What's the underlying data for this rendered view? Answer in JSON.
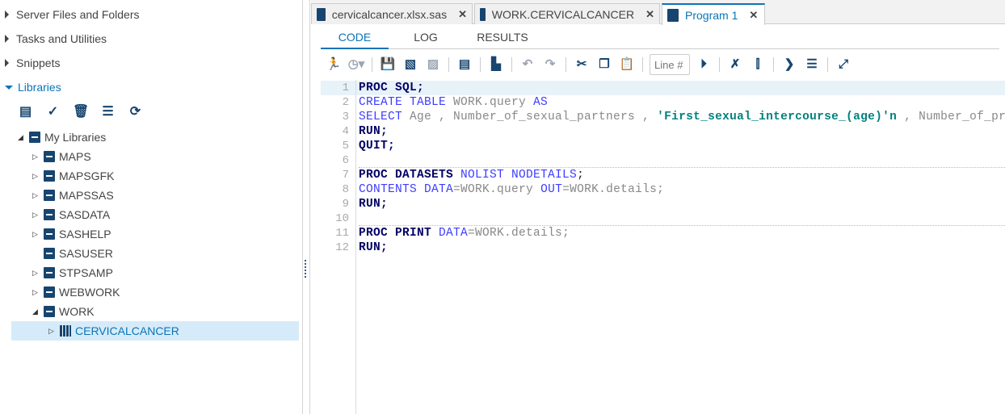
{
  "left": {
    "sections": [
      {
        "label": "Server Files and Folders",
        "expanded": false
      },
      {
        "label": "Tasks and Utilities",
        "expanded": false
      },
      {
        "label": "Snippets",
        "expanded": false
      },
      {
        "label": "Libraries",
        "expanded": true
      }
    ],
    "lib_tools": [
      {
        "icon": "new-library-icon"
      },
      {
        "icon": "properties-icon"
      },
      {
        "icon": "delete-icon"
      },
      {
        "icon": "view-columns-icon"
      },
      {
        "icon": "refresh-icon"
      }
    ],
    "root": "My Libraries",
    "libraries": [
      {
        "name": "MAPS",
        "expandable": true
      },
      {
        "name": "MAPSGFK",
        "expandable": true
      },
      {
        "name": "MAPSSAS",
        "expandable": true
      },
      {
        "name": "SASDATA",
        "expandable": true
      },
      {
        "name": "SASHELP",
        "expandable": true
      },
      {
        "name": "SASUSER",
        "expandable": false
      },
      {
        "name": "STPSAMP",
        "expandable": true
      },
      {
        "name": "WEBWORK",
        "expandable": true
      },
      {
        "name": "WORK",
        "expandable": true,
        "expanded": true
      }
    ],
    "work_child": "CERVICALCANCER"
  },
  "tabs": [
    {
      "label": "cervicalcancer.xlsx.sas",
      "close": "✕"
    },
    {
      "label": "WORK.CERVICALCANCER",
      "close": "✕"
    },
    {
      "label": "Program 1",
      "close": "✕",
      "active": true
    }
  ],
  "subtabs": [
    "CODE",
    "LOG",
    "RESULTS"
  ],
  "toolbar": {
    "line_placeholder": "Line #"
  },
  "code": [
    [
      [
        "PROC SQL;",
        "k1"
      ]
    ],
    [
      [
        "CREATE TABLE ",
        "k2"
      ],
      [
        "WORK.query ",
        "id"
      ],
      [
        "AS",
        "k2"
      ]
    ],
    [
      [
        "SELECT ",
        "k2"
      ],
      [
        "Age , Number_of_sexual_partners , ",
        "id"
      ],
      [
        "'First_sexual_intercourse_(age)'n",
        "str"
      ],
      [
        " , Number_of_pregnancies",
        "id"
      ]
    ],
    [
      [
        "RUN;",
        "k1"
      ]
    ],
    [
      [
        "QUIT;",
        "k1"
      ]
    ],
    [],
    [
      [
        "PROC DATASETS ",
        "k1"
      ],
      [
        "NOLIST NODETAILS",
        "k2"
      ],
      [
        ";",
        "pn"
      ]
    ],
    [
      [
        "CONTENTS DATA",
        "k2"
      ],
      [
        "=WORK.query ",
        "id"
      ],
      [
        "OUT",
        "k2"
      ],
      [
        "=WORK.details;",
        "id"
      ]
    ],
    [
      [
        "RUN;",
        "k1"
      ]
    ],
    [],
    [
      [
        "PROC PRINT ",
        "k1"
      ],
      [
        "DATA",
        "k2"
      ],
      [
        "=WORK.details;",
        "id"
      ]
    ],
    [
      [
        "RUN;",
        "k1"
      ]
    ]
  ]
}
